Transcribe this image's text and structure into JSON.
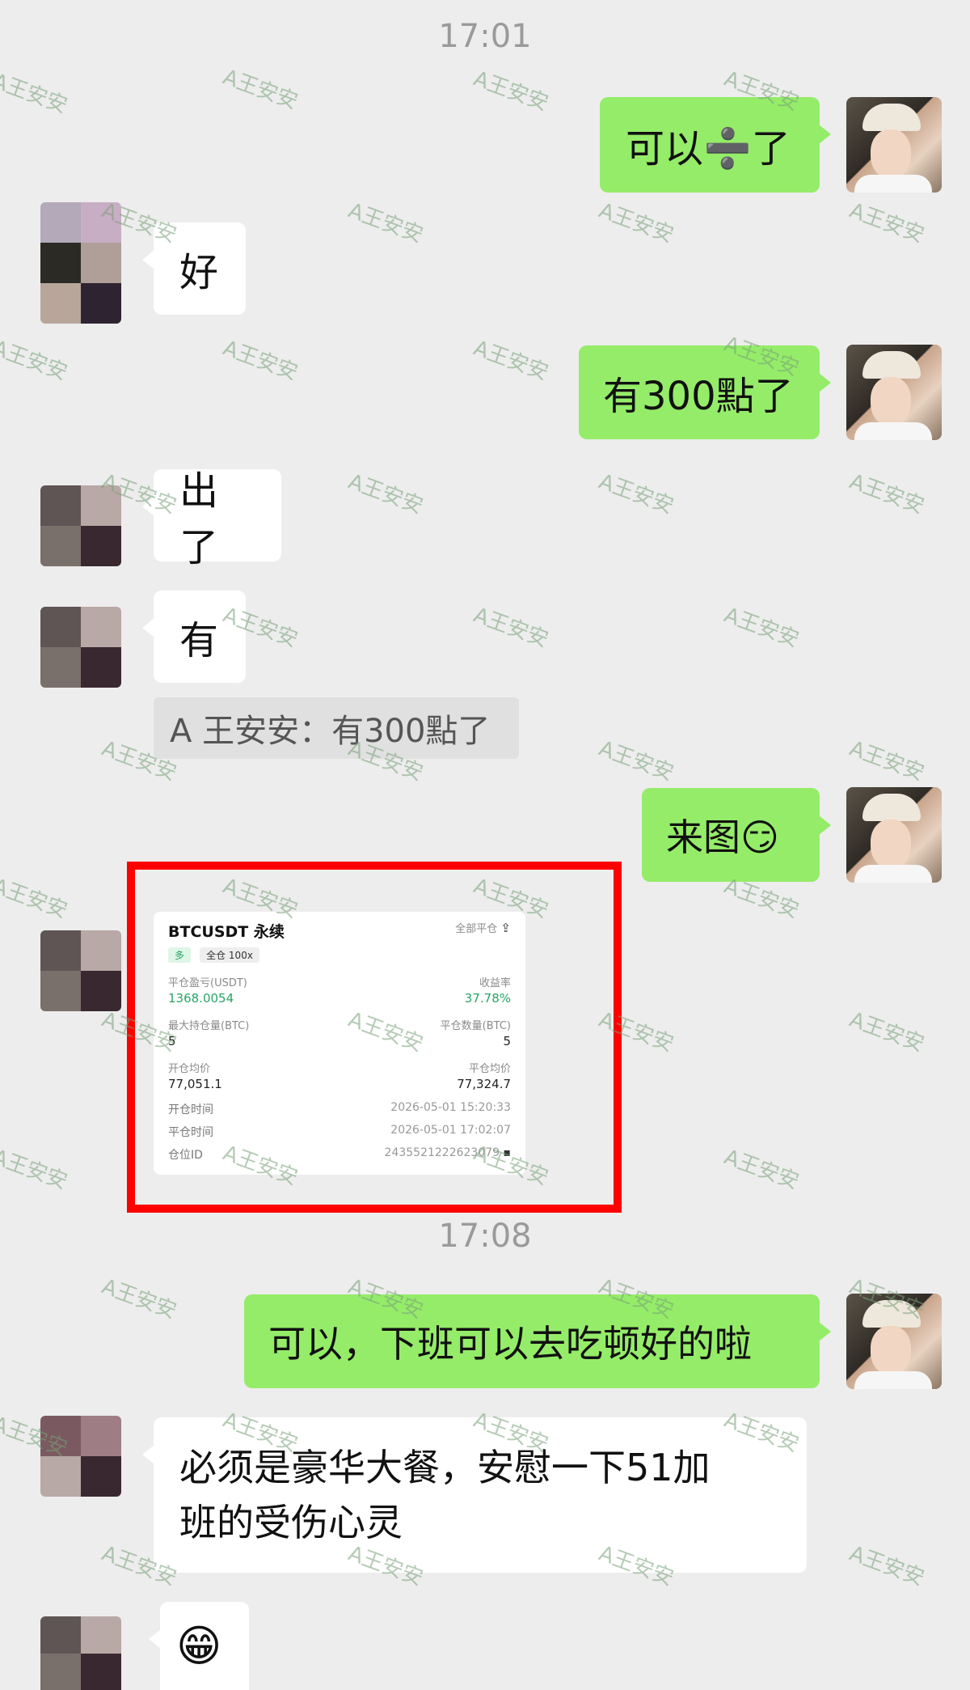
{
  "timestamps": [
    "17:01",
    "17:08"
  ],
  "messages": {
    "m1": "可以➗了",
    "m2": "好",
    "m3": "有300點了",
    "m4": "出了",
    "m5": "有",
    "m6": "来图😏",
    "m7": "可以，下班可以去吃顿好的啦",
    "m8_line1": "必须是豪华大餐，安慰一下51加",
    "m8_line2": "班的受伤心灵",
    "m9": "😁"
  },
  "quote": {
    "text": "A 王安安：有300點了"
  },
  "trade_card": {
    "symbol": "BTCUSDT 永续",
    "close_all": "全部平仓",
    "side_tag": "多",
    "mode_tag": "全仓 100x",
    "pnl_label": "平仓盈亏(USDT)",
    "pnl_value": "1368.0054",
    "roi_label": "收益率",
    "roi_value": "37.78%",
    "max_pos_label": "最大持仓量(BTC)",
    "max_pos_value": "5",
    "close_qty_label": "平仓数量(BTC)",
    "close_qty_value": "5",
    "open_avg_label": "开仓均价",
    "open_avg_value": "77,051.1",
    "close_avg_label": "平仓均价",
    "close_avg_value": "77,324.7",
    "open_time_label": "开仓时间",
    "open_time_value": "2026-05-01 15:20:33",
    "close_time_label": "平仓时间",
    "close_time_value": "2026-05-01 17:02:07",
    "position_id_label": "仓位ID",
    "position_id_value": "2435521222623079"
  },
  "watermark_text": "A王安安",
  "colors": {
    "background": "#ededed",
    "sent_bubble": "#95ec69",
    "received_bubble": "#ffffff",
    "highlight_frame": "#ff0000",
    "profit_green": "#27a566"
  }
}
